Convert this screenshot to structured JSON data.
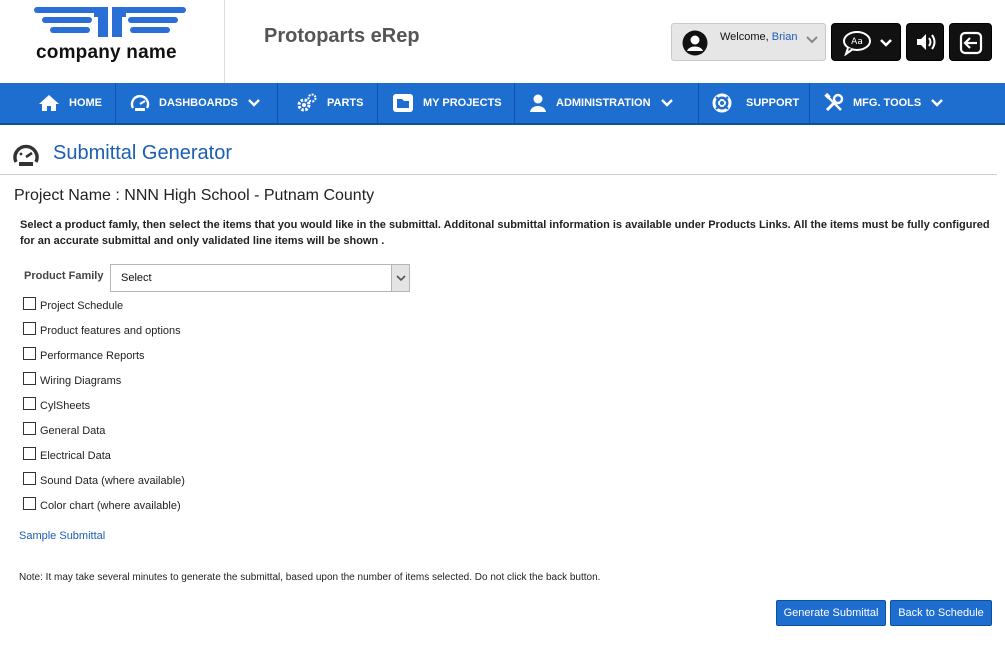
{
  "header": {
    "company_name": "company name",
    "app_title": "Protoparts eRep",
    "welcome_label": "Welcome,",
    "user_name": "Brian"
  },
  "nav": {
    "items": [
      {
        "label": "HOME",
        "icon": "home-icon"
      },
      {
        "label": "DASHBOARDS",
        "icon": "gauge-icon",
        "dropdown": true
      },
      {
        "label": "PARTS",
        "icon": "gears-icon"
      },
      {
        "label": "MY PROJECTS",
        "icon": "folder-icon"
      },
      {
        "label": "ADMINISTRATION",
        "icon": "user-icon",
        "dropdown": true
      },
      {
        "label": "SUPPORT",
        "icon": "lifebuoy-icon"
      },
      {
        "label": "MFG. TOOLS",
        "icon": "wrench-screwdriver-icon",
        "dropdown": true
      }
    ]
  },
  "page": {
    "title": "Submittal Generator",
    "project_name": "Project Name : NNN High School - Putnam County",
    "instructions": "Select a product famly, then select the items that you would like in the submittal. Additonal submittal information is available under Products Links. All the items must be fully configured for an accurate submittal and only validated line items will be shown .",
    "product_family_label": "Product Family",
    "product_family_value": "Select",
    "checkboxes": [
      "Project Schedule",
      "Product features and options",
      "Performance Reports",
      "Wiring Diagrams",
      "CylSheets",
      "General Data",
      "Electrical Data",
      "Sound Data (where available)",
      "Color chart (where available)"
    ],
    "sample_link": "Sample Submittal",
    "note": "Note: It may take several minutes to generate the submittal, based upon the number of items selected. Do not click the back button.",
    "generate_button": "Generate Submittal",
    "back_button": "Back to Schedule"
  },
  "colors": {
    "nav_bg": "#1e6ed0",
    "link": "#1b5fb4",
    "logo_blue": "#2a6fd6"
  }
}
